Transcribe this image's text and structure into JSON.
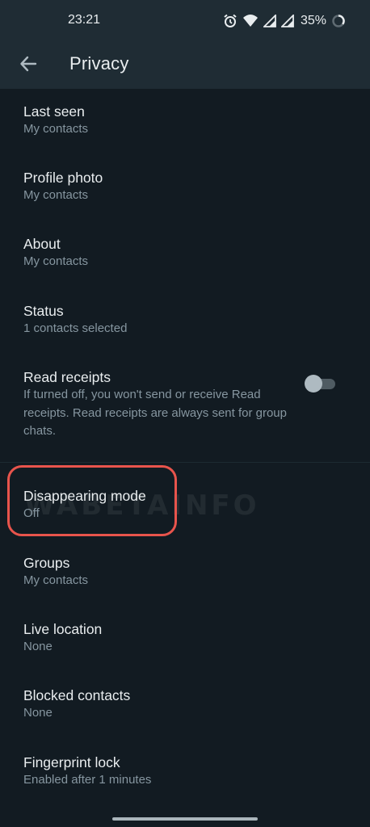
{
  "status_bar": {
    "time": "23:21",
    "battery": "35%",
    "icons": [
      "alarm-icon",
      "wifi-icon",
      "signal-icon",
      "signal-icon",
      "battery-icon"
    ]
  },
  "header": {
    "title": "Privacy",
    "back_icon": "arrow-left-icon"
  },
  "settings": [
    {
      "title": "Last seen",
      "value": "My contacts"
    },
    {
      "title": "Profile photo",
      "value": "My contacts"
    },
    {
      "title": "About",
      "value": "My contacts"
    },
    {
      "title": "Status",
      "value": "1 contacts selected"
    },
    {
      "title": "Read receipts",
      "description": "If turned off, you won't send or receive Read receipts. Read receipts are always sent for group chats.",
      "toggle_on": false
    },
    {
      "title": "Disappearing mode",
      "value": "Off"
    },
    {
      "title": "Groups",
      "value": "My contacts"
    },
    {
      "title": "Live location",
      "value": "None"
    },
    {
      "title": "Blocked contacts",
      "value": "None"
    },
    {
      "title": "Fingerprint lock",
      "value": "Enabled after 1 minutes"
    }
  ],
  "watermark": "WABETAINFO",
  "colors": {
    "background": "#121b22",
    "header": "#1f2c34",
    "primary_text": "#e9edef",
    "secondary_text": "#8696a0",
    "highlight": "#e8544c"
  }
}
